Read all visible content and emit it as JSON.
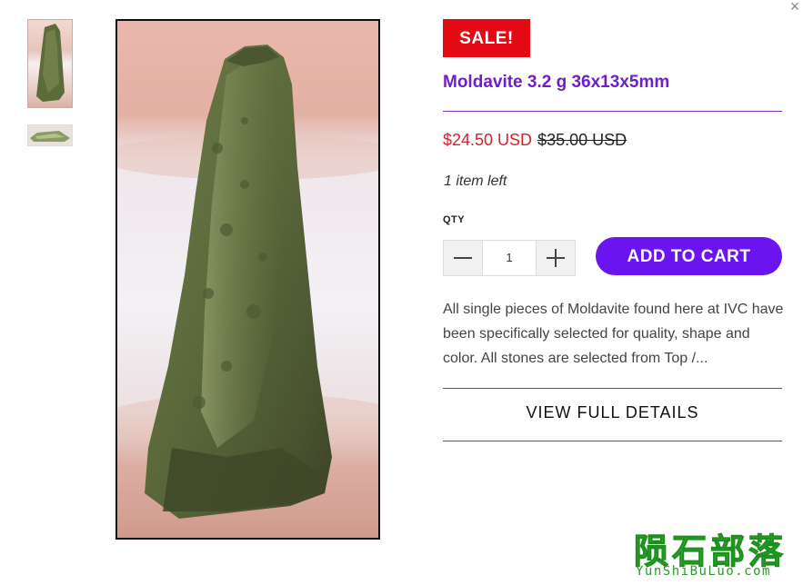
{
  "modal": {
    "close_symbol": "×"
  },
  "gallery": {
    "thumbnails": [
      {
        "name": "thumb-front"
      },
      {
        "name": "thumb-side"
      }
    ]
  },
  "product": {
    "badge": "SALE!",
    "title": "Moldavite 3.2 g 36x13x5mm",
    "price_current": "$24.50 USD",
    "price_original": "$35.00 USD",
    "stock": "1 item left",
    "qty_label": "QTY",
    "qty_value": "1",
    "add_to_cart": "ADD TO CART",
    "description": "All single pieces of Moldavite found here at IVC have been specifically selected for quality, shape and color. All stones are selected from Top /...",
    "view_details": "VIEW FULL DETAILS"
  },
  "watermark": {
    "chinese": "陨石部落",
    "latin": "YunShiBuLuo.com"
  },
  "colors": {
    "accent": "#6f1ec9",
    "button": "#6a14f0",
    "sale": "#e50914",
    "price": "#d8202d",
    "watermark": "#2fb52f"
  }
}
